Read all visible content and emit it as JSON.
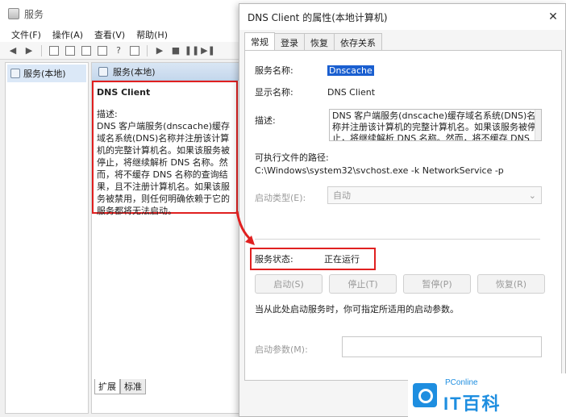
{
  "services_window": {
    "title": "服务",
    "menu": [
      "文件(F)",
      "操作(A)",
      "查看(V)",
      "帮助(H)"
    ],
    "tree_root": "服务(本地)",
    "main_header": "服务(本地)",
    "selected_service": {
      "name": "DNS Client",
      "desc_label": "描述:",
      "desc_text": "DNS 客户端服务(dnscache)缓存域名系统(DNS)名称并注册该计算机的完整计算机名。如果该服务被停止，将继续解析 DNS 名称。然而，将不缓存 DNS 名称的查询结果，且不注册计算机名。如果该服务被禁用，则任何明确依赖于它的服务都将无法启动。"
    },
    "bottom_tabs": [
      "扩展",
      "标准"
    ]
  },
  "dialog": {
    "title": "DNS Client 的属性(本地计算机)",
    "tabs": [
      "常规",
      "登录",
      "恢复",
      "依存关系"
    ],
    "service_name_label": "服务名称:",
    "service_name_value": "Dnscache",
    "display_name_label": "显示名称:",
    "display_name_value": "DNS Client",
    "description_label": "描述:",
    "description_value": "DNS 客户端服务(dnscache)缓存域名系统(DNS)名称并注册该计算机的完整计算机名。如果该服务被停止，将继续解析 DNS 名称。然而，将不缓存 DNS 名称的",
    "exe_path_label": "可执行文件的路径:",
    "exe_path_value": "C:\\Windows\\system32\\svchost.exe -k NetworkService -p",
    "startup_type_label": "启动类型(E):",
    "startup_type_value": "自动",
    "status_label": "服务状态:",
    "status_value": "正在运行",
    "buttons": [
      "启动(S)",
      "停止(T)",
      "暂停(P)",
      "恢复(R)"
    ],
    "hint": "当从此处启动服务时，你可指定所适用的启动参数。",
    "start_params_label": "启动参数(M):"
  },
  "watermark": {
    "small": "PConline",
    "big": "IT百科"
  },
  "colors": {
    "highlight_red": "#e02020",
    "selection_blue": "#1a5fd0",
    "logo_blue": "#1e8ee0"
  }
}
